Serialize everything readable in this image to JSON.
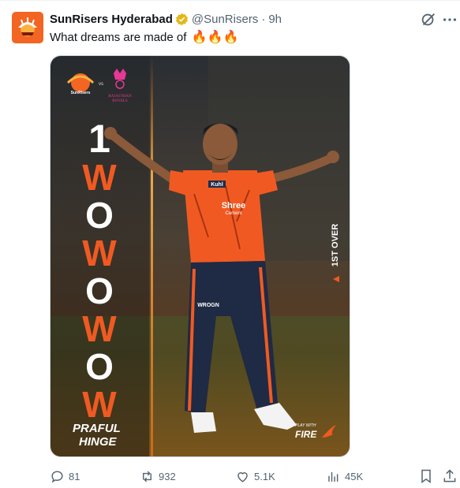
{
  "tweet": {
    "display_name": "SunRisers Hyderabad",
    "handle": "@SunRisers",
    "separator": "·",
    "time": "9h",
    "text": "What dreams are made of",
    "emoji": "🔥🔥🔥"
  },
  "media": {
    "team_home": "SunRisers",
    "vs": "vs",
    "team_away_line1": "RAJASTHAN",
    "team_away_line2": "ROYALS",
    "figures": [
      "1",
      "W",
      "O",
      "W",
      "O",
      "W",
      "O",
      "W"
    ],
    "over_label": "1ST OVER",
    "player_first": "PRAFUL",
    "player_last": "HINGE",
    "jersey_sponsor": "Shree",
    "jersey_sponsor_sub": "Cement",
    "jersey_chest": "Kuhl",
    "trouser_brand": "WROGN",
    "slogan_line1": "PLAY WITH",
    "slogan_line2": "FIRE"
  },
  "actions": {
    "replies": "81",
    "reposts": "932",
    "likes": "5.1K",
    "views": "45K"
  },
  "colors": {
    "accent": "#1d9bf0",
    "verified_gold": "#e2b719",
    "srh_orange": "#f05a22",
    "muted": "#536471"
  },
  "icons": [
    "grok-icon",
    "more-icon",
    "reply-icon",
    "repost-icon",
    "like-icon",
    "views-icon",
    "bookmark-icon",
    "share-icon",
    "verified-badge-icon"
  ]
}
